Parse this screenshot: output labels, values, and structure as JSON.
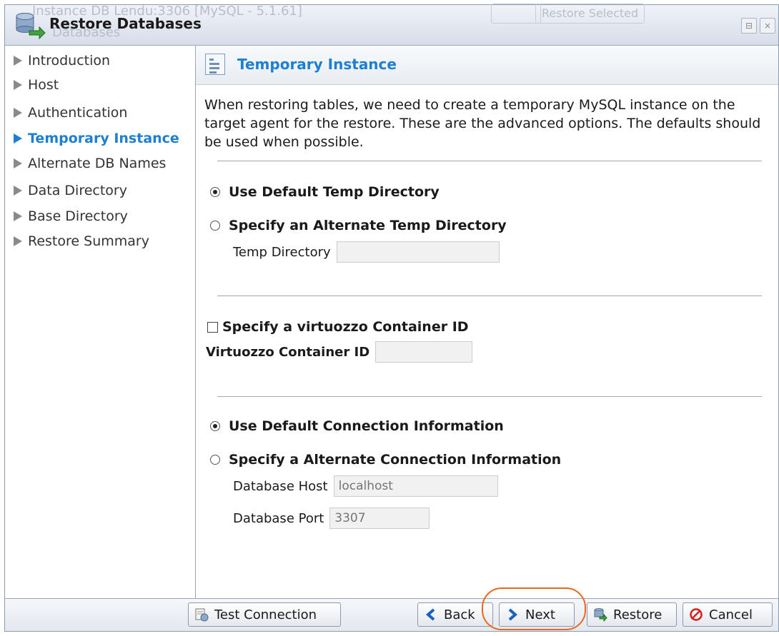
{
  "window": {
    "title": "Restore Databases",
    "background_text": "Instance DB Lendu:3306 [MySQL - 5.1.61]",
    "background_text_2": "Databases",
    "background_button": "Restore Selected"
  },
  "nav": {
    "items": [
      {
        "label": "Introduction",
        "active": false
      },
      {
        "label": "Host",
        "active": false
      },
      {
        "label": "Authentication",
        "active": false
      },
      {
        "label": "Temporary Instance",
        "active": true
      },
      {
        "label": "Alternate DB Names",
        "active": false
      },
      {
        "label": "Data Directory",
        "active": false
      },
      {
        "label": "Base Directory",
        "active": false
      },
      {
        "label": "Restore Summary",
        "active": false
      }
    ]
  },
  "panel": {
    "title": "Temporary Instance",
    "description": "When restoring tables, we need to create a temporary MySQL instance on the target agent for the restore. These are the advanced options. The defaults should be used when possible.",
    "temp_dir": {
      "default_label": "Use Default Temp Directory",
      "default_selected": true,
      "alternate_label": "Specify an Alternate Temp Directory",
      "alternate_selected": false,
      "field_label": "Temp Directory",
      "field_value": ""
    },
    "container": {
      "checkbox_label": "Specify a virtuozzo Container ID",
      "checked": false,
      "field_label": "Virtuozzo Container ID",
      "field_value": ""
    },
    "connection": {
      "default_label": "Use Default Connection Information",
      "default_selected": true,
      "alternate_label": "Specify a Alternate Connection Information",
      "alternate_selected": false,
      "host_label": "Database Host",
      "host_placeholder": "localhost",
      "port_label": "Database Port",
      "port_placeholder": "3307"
    }
  },
  "footer": {
    "test_connection": "Test Connection",
    "back": "Back",
    "next": "Next",
    "restore": "Restore",
    "cancel": "Cancel"
  },
  "colors": {
    "accent": "#1d7ed6",
    "highlight": "#e8681f"
  }
}
